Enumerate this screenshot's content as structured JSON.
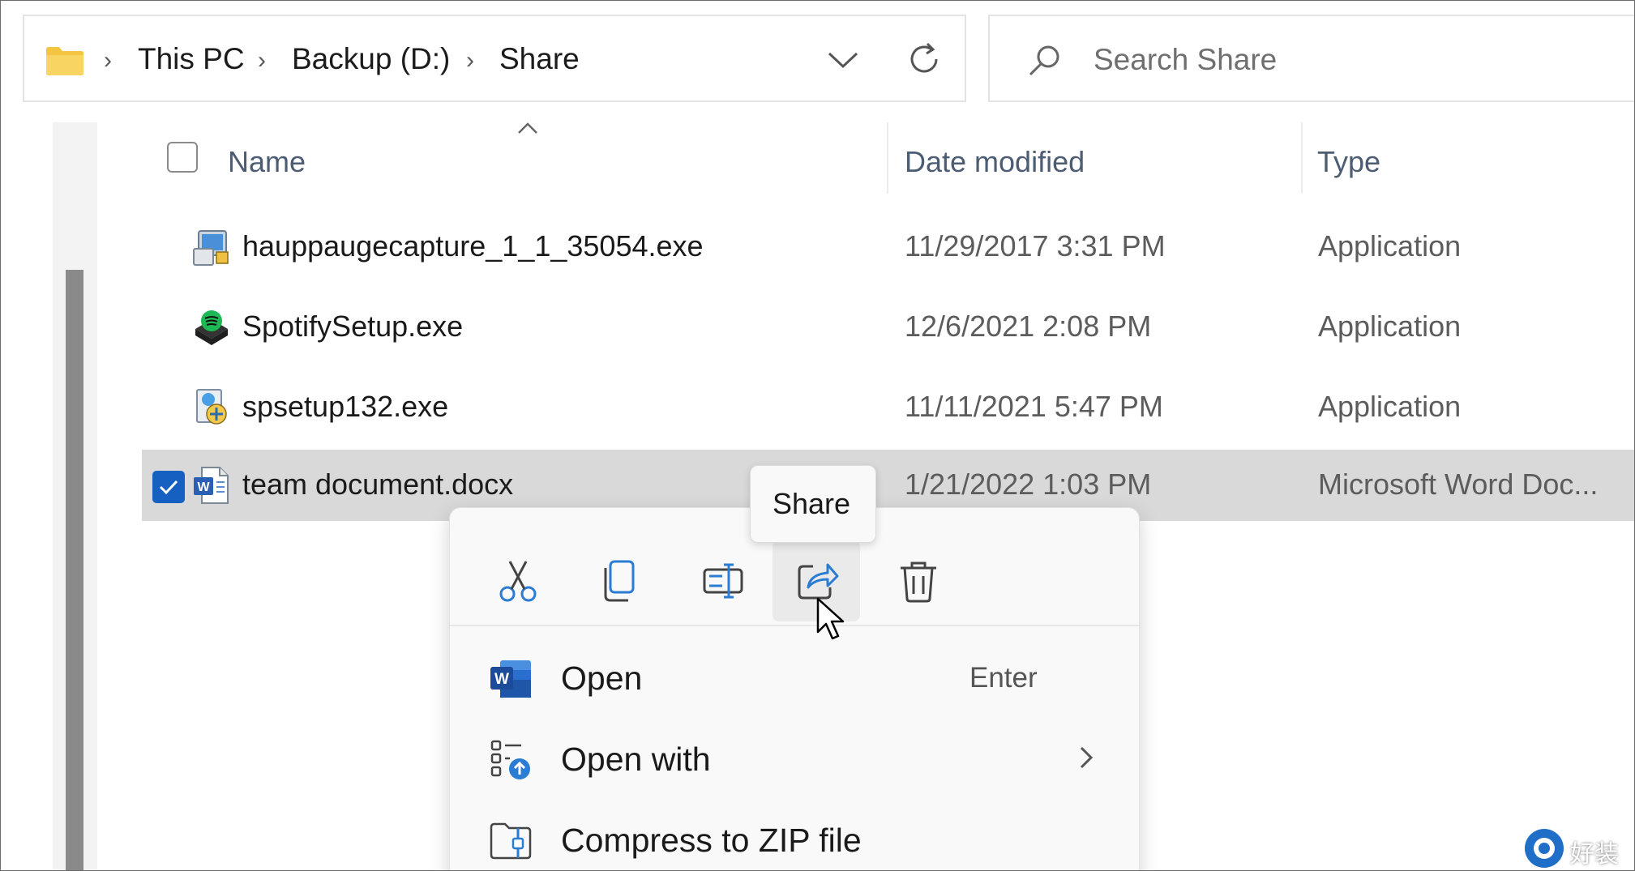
{
  "address_bar": {
    "breadcrumbs": [
      "This PC",
      "Backup (D:)",
      "Share"
    ]
  },
  "search": {
    "placeholder": "Search Share"
  },
  "columns": {
    "name": "Name",
    "date_modified": "Date modified",
    "type": "Type"
  },
  "files": [
    {
      "name": "hauppaugecapture_1_1_35054.exe",
      "date": "11/29/2017 3:31 PM",
      "type": "Application",
      "icon": "installer-icon",
      "selected": false
    },
    {
      "name": "SpotifySetup.exe",
      "date": "12/6/2021 2:08 PM",
      "type": "Application",
      "icon": "spotify-icon",
      "selected": false
    },
    {
      "name": "spsetup132.exe",
      "date": "11/11/2021 5:47 PM",
      "type": "Application",
      "icon": "setup-icon",
      "selected": false
    },
    {
      "name": "team document.docx",
      "date": "1/21/2022 1:03 PM",
      "type": "Microsoft Word Doc...",
      "icon": "word-doc-icon",
      "selected": true
    }
  ],
  "tooltip": {
    "text": "Share"
  },
  "context_menu": {
    "toolbar": [
      "cut-icon",
      "copy-icon",
      "rename-icon",
      "share-icon",
      "delete-icon"
    ],
    "items": [
      {
        "label": "Open",
        "shortcut": "Enter",
        "icon": "word-icon"
      },
      {
        "label": "Open with",
        "icon": "open-with-icon",
        "submenu": true
      },
      {
        "label": "Compress to ZIP file",
        "icon": "zip-folder-icon"
      }
    ]
  },
  "watermark": {
    "text": "好装机"
  },
  "colors": {
    "accent": "#1560c0",
    "selected_row": "#d9d9d9",
    "header_text": "#4b5c73",
    "icon_blue": "#2b7cd3"
  }
}
